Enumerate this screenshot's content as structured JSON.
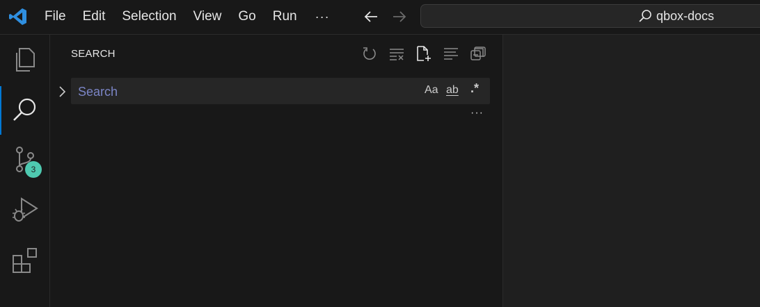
{
  "titlebar": {
    "menu": [
      "File",
      "Edit",
      "Selection",
      "View",
      "Go",
      "Run"
    ],
    "more": "···",
    "command_center": "qbox-docs"
  },
  "activitybar": {
    "items": [
      {
        "icon": "files-icon"
      },
      {
        "icon": "search-icon",
        "active": true
      },
      {
        "icon": "source-control-icon",
        "badge": "3"
      },
      {
        "icon": "run-debug-icon"
      },
      {
        "icon": "extensions-icon"
      }
    ]
  },
  "sidebar": {
    "title": "SEARCH",
    "search": {
      "placeholder": "Search",
      "value": ""
    },
    "options": {
      "match_case": "Aa",
      "whole_word": "ab",
      "regex": ".*"
    },
    "more": "···"
  },
  "colors": {
    "accent": "#0078d4",
    "badge": "#4ec9b0",
    "placeholder": "#7b85c6"
  }
}
